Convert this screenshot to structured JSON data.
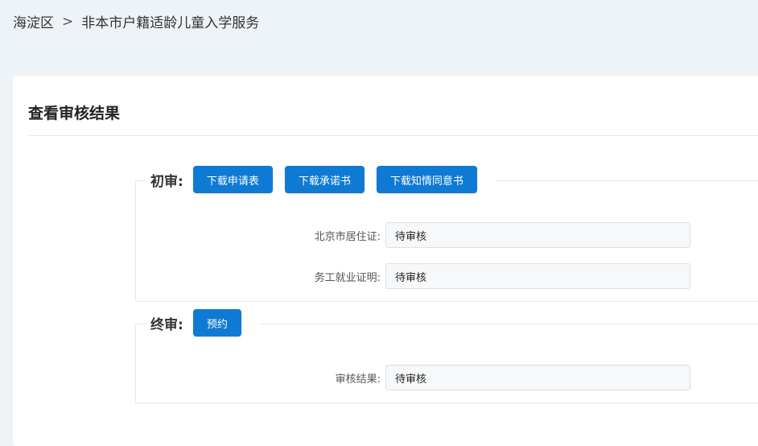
{
  "breadcrumb": {
    "district": "海淀区",
    "separator": ">",
    "service": "非本市户籍适龄儿童入学服务"
  },
  "page_title": "查看审核结果",
  "initial_review": {
    "label": "初审:",
    "buttons": [
      "下载申请表",
      "下载承诺书",
      "下载知情同意书"
    ],
    "fields": [
      {
        "label": "北京市居住证:",
        "value": "待审核"
      },
      {
        "label": "务工就业证明:",
        "value": "待审核"
      }
    ]
  },
  "final_review": {
    "label": "终审:",
    "button": "预约",
    "fields": [
      {
        "label": "审核结果:",
        "value": "待审核"
      }
    ]
  },
  "colors": {
    "background": "#eef3f7",
    "card": "#ffffff",
    "accent": "#0f7ad4",
    "field_bg": "#f7f8fa",
    "border": "#dcdfe6"
  }
}
